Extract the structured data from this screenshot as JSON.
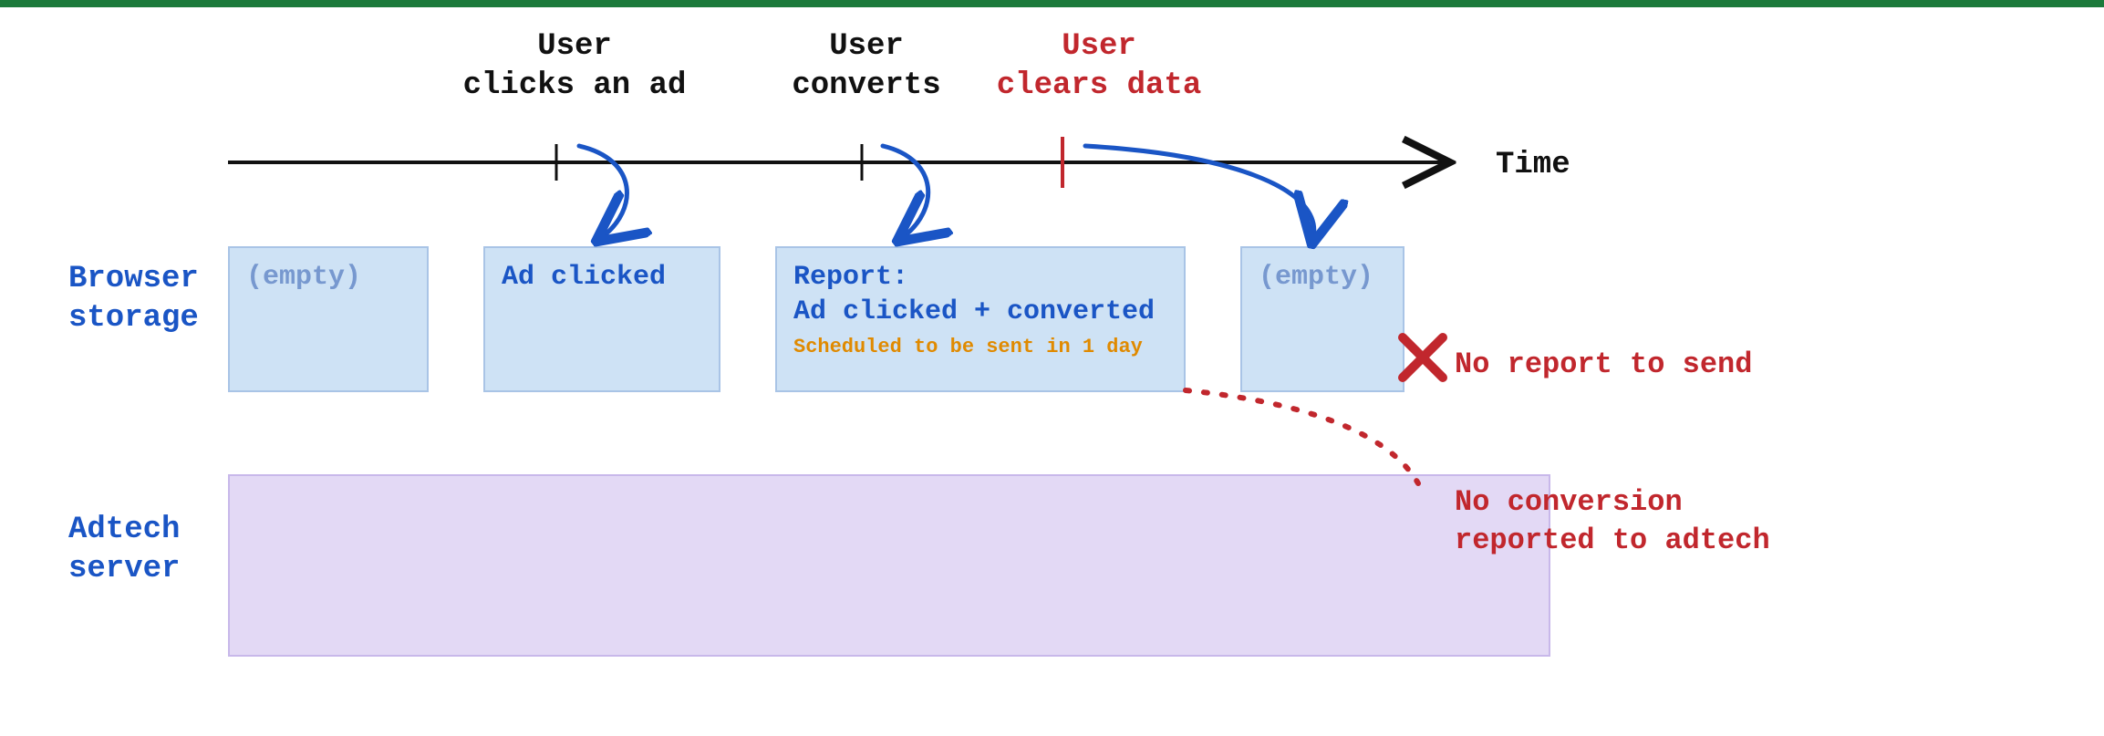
{
  "timeline": {
    "axis_label": "Time",
    "events": [
      {
        "id": "click",
        "label": "User\nclicks an ad",
        "color": "black"
      },
      {
        "id": "convert",
        "label": "User\nconverts",
        "color": "black"
      },
      {
        "id": "clear",
        "label": "User\nclears data",
        "color": "red"
      }
    ]
  },
  "rows": {
    "browser_storage": {
      "label": "Browser\nstorage"
    },
    "adtech_server": {
      "label": "Adtech\nserver"
    }
  },
  "storage_states": [
    {
      "id": "s0",
      "title": "(empty)",
      "title_color": "blue-faded"
    },
    {
      "id": "s1",
      "title": "Ad clicked",
      "title_color": "blue"
    },
    {
      "id": "s2",
      "title": "Report:\nAd clicked + converted",
      "title_color": "blue",
      "sub": "Scheduled to be sent in 1 day",
      "sub_color": "orange"
    },
    {
      "id": "s3",
      "title": "(empty)",
      "title_color": "blue-faded"
    }
  ],
  "errors": {
    "no_report": "No report to send",
    "no_conversion": "No conversion\nreported to adtech"
  },
  "palette": {
    "blue": "#1a55c5",
    "blue_faded": "#7798cf",
    "red": "#c1272d",
    "orange": "#e08a00",
    "storage_fill": "#cee2f5",
    "storage_border": "#a9c4e6",
    "server_fill": "#e3d9f5",
    "server_border": "#c8b8ea"
  }
}
